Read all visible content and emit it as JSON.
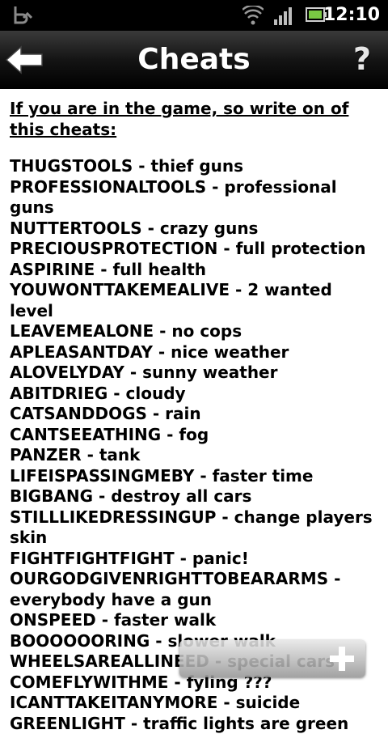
{
  "status_bar": {
    "time": "12:10"
  },
  "header": {
    "title": "Cheats"
  },
  "content": {
    "intro": "If you are in the game, so write on of this cheats:",
    "cheats": [
      "THUGSTOOLS - thief guns",
      "PROFESSIONALTOOLS - professional guns",
      "NUTTERTOOLS - crazy guns",
      "PRECIOUSPROTECTION - full protection",
      "ASPIRINE - full health",
      "YOUWONTTAKEMEALIVE - 2 wanted level",
      "LEAVEMEALONE - no cops",
      "APLEASANTDAY - nice weather",
      "ALOVELYDAY - sunny weather",
      "ABITDRIEG - cloudy",
      "CATSANDDOGS - rain",
      "CANTSEEATHING - fog",
      "PANZER - tank",
      "LIFEISPASSINGMEBY - faster time",
      "BIGBANG - destroy all cars",
      "STILLLIKEDRESSINGUP - change players skin",
      "FIGHTFIGHTFIGHT - panic!",
      "OURGODGIVENRIGHTTOBEARARMS - everybody have a gun",
      "ONSPEED - faster walk",
      "BOOOOOORING - slower walk",
      "WHEELSAREALLINEED - special cars",
      "COMEFLYWITHME - fyling ???",
      "ICANTTAKEITANYMORE - suicide",
      "GREENLIGHT - traffic lights are green"
    ]
  },
  "icons": {
    "back": "arrow-left-icon",
    "help": "question-mark-icon",
    "add": "plus-icon"
  },
  "colors": {
    "header_bg": "#000000",
    "text": "#000000",
    "page_bg": "#ffffff"
  }
}
